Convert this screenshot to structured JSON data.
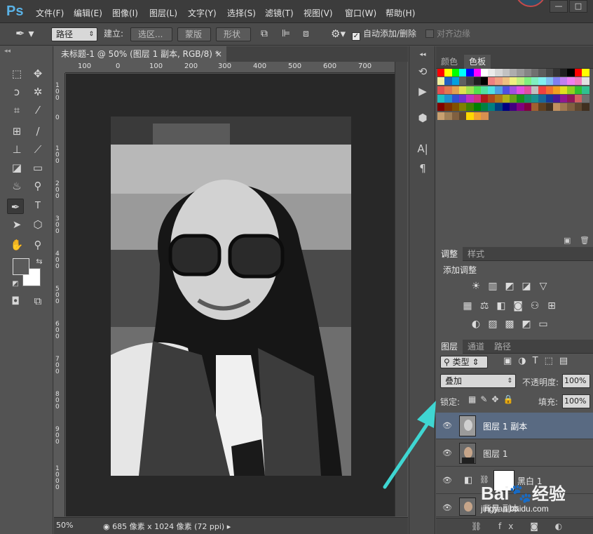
{
  "app": {
    "logo": "Ps",
    "window_buttons": [
      "—",
      "□"
    ]
  },
  "menu": [
    "文件(F)",
    "编辑(E)",
    "图像(I)",
    "图层(L)",
    "文字(Y)",
    "选择(S)",
    "滤镜(T)",
    "视图(V)",
    "窗口(W)",
    "帮助(H)"
  ],
  "options": {
    "mode_select": "路径",
    "make_label": "建立:",
    "selection_button": "选区...",
    "mask_button": "蒙版",
    "shape_button": "形状",
    "auto_add_delete": "自动添加/删除",
    "auto_add_checked": true,
    "align_edges": "对齐边缘",
    "align_checked": false
  },
  "document": {
    "tab_title": "未标题-1 @ 50% (图层 1 副本, RGB/8) *",
    "close": "×",
    "ruler_h": [
      "100",
      "0",
      "100",
      "200",
      "300",
      "400",
      "500",
      "600",
      "700"
    ],
    "ruler_v": [
      "1 0 0",
      "0",
      "1 0 0",
      "2 0 0",
      "3 0 0",
      "4 0 0",
      "5 0 0",
      "6 0 0",
      "7 0 0",
      "8 0 0",
      "9 0 0",
      "1 0 0 0"
    ],
    "zoom": "50%",
    "doc_info": "685 像素 x 1024 像素 (72 ppi)"
  },
  "swatches_panel": {
    "tabs": [
      "颜色",
      "色板"
    ],
    "active_tab": "色板",
    "row1": [
      "#ff0000",
      "#ffff00",
      "#00ff00",
      "#00ffff",
      "#0000ff",
      "#ff00ff",
      "#ffffff",
      "#ebebeb",
      "#d6d6d6",
      "#c2c2c2",
      "#adadad",
      "#999999",
      "#858585",
      "#707070",
      "#5c5c5c",
      "#474747",
      "#333333",
      "#1f1f1f",
      "#000000",
      "#ff0000",
      "#ffff00"
    ],
    "row2": [
      "#f0f0a0",
      "#2060c0",
      "#00a0e0",
      "#606060",
      "#404040",
      "#202020",
      "#000000",
      "#f08080",
      "#f0a080",
      "#f0c080",
      "#f0f080",
      "#c0f080",
      "#80f080",
      "#80f0c0",
      "#80f0f0",
      "#80c0f0",
      "#8080f0",
      "#c080f0",
      "#f080f0",
      "#f080c0",
      "#e0e0e0"
    ],
    "row3": [
      "#e05050",
      "#e07850",
      "#e0a050",
      "#e0e050",
      "#a0e050",
      "#50e050",
      "#50e0a0",
      "#50e0e0",
      "#50a0e0",
      "#5050e0",
      "#a050e0",
      "#e050e0",
      "#e050a0",
      "#c0c0c0",
      "#f04040",
      "#f07030",
      "#f0a020",
      "#e0e020",
      "#90d020",
      "#30c030",
      "#30c090"
    ],
    "row4": [
      "#20c0c0",
      "#2090d0",
      "#3050d0",
      "#7030d0",
      "#c030c0",
      "#d03080",
      "#b01818",
      "#b04818",
      "#b07818",
      "#b0b018",
      "#68a018",
      "#189018",
      "#189068",
      "#189090",
      "#186898",
      "#183898",
      "#481898",
      "#901890",
      "#901858",
      "#d06060",
      "#707070"
    ],
    "row5": [
      "#800000",
      "#803000",
      "#805000",
      "#808000",
      "#408000",
      "#008000",
      "#008040",
      "#008080",
      "#004080",
      "#000080",
      "#400080",
      "#800080",
      "#800040",
      "#a06030",
      "#604020",
      "#403020",
      "#c09060",
      "#a07850",
      "#806040",
      "#604830",
      "#403020"
    ],
    "row6": [
      "#c8a070",
      "#a08058",
      "#806040",
      "#604830",
      "#ffd700",
      "#f0a030",
      "#d89050"
    ]
  },
  "adjustments_panel": {
    "tabs": [
      "调整",
      "样式"
    ],
    "title": "添加调整",
    "icons": [
      "brightness-contrast-icon",
      "levels-icon",
      "curves-icon",
      "exposure-icon",
      "vibrance-icon",
      "hue-saturation-icon",
      "color-balance-icon",
      "black-white-icon",
      "photo-filter-icon",
      "channel-mixer-icon",
      "color-lookup-icon",
      "invert-icon",
      "posterize-icon",
      "threshold-icon",
      "selective-color-icon",
      "gradient-map-icon"
    ]
  },
  "layers_panel": {
    "tabs": [
      "图层",
      "通道",
      "路径"
    ],
    "filter_label": "类型",
    "blend_mode": "叠加",
    "opacity_label": "不透明度:",
    "opacity_value": "100%",
    "lock_label": "锁定:",
    "fill_label": "填充:",
    "fill_value": "100%",
    "layers": [
      {
        "name": "图层 1 副本",
        "selected": true
      },
      {
        "name": "图层 1",
        "selected": false
      },
      {
        "name": "黑白 1",
        "selected": false
      },
      {
        "name": "背景 副本",
        "selected": false
      }
    ]
  },
  "annotation": {
    "arrow_color": "#3fd6d2"
  },
  "watermark": {
    "brand": "Bai",
    "brand2": "经验",
    "url": "jingyan.baidu.com"
  }
}
